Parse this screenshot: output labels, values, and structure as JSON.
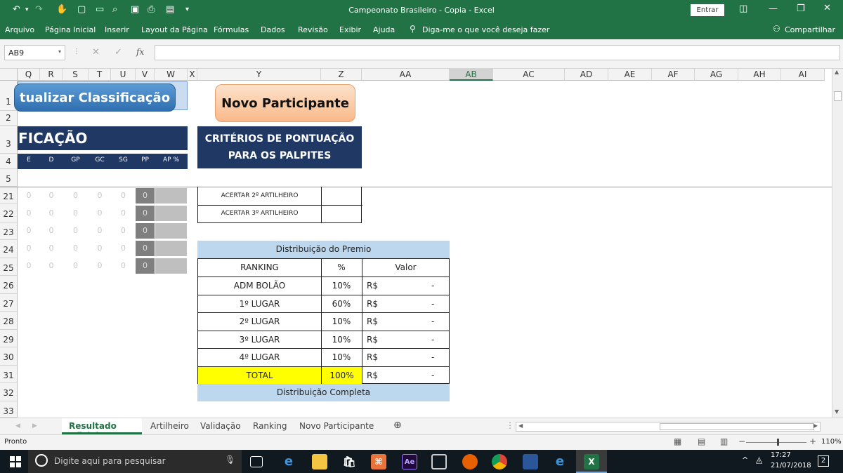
{
  "window": {
    "title": "Campeonato Brasileiro - Copia  -  Excel",
    "signin_label": "Entrar"
  },
  "ribbon": {
    "tabs": [
      "Arquivo",
      "Página Inicial",
      "Inserir",
      "Layout da Página",
      "Fórmulas",
      "Dados",
      "Revisão",
      "Exibir",
      "Ajuda"
    ],
    "tell_me": "Diga-me o que você deseja fazer",
    "share": "Compartilhar"
  },
  "formula_bar": {
    "name_box": "AB9",
    "fx": "fx",
    "formula": ""
  },
  "columns": [
    "Q",
    "R",
    "S",
    "T",
    "U",
    "V",
    "W",
    "X",
    "Y",
    "Z",
    "AA",
    "AB",
    "AC",
    "AD",
    "AE",
    "AF",
    "AG",
    "AH",
    "AI"
  ],
  "rows": [
    "1",
    "2",
    "3",
    "4",
    "5",
    "21",
    "22",
    "23",
    "24",
    "25",
    "26",
    "27",
    "28",
    "29",
    "30",
    "31",
    "32",
    "33"
  ],
  "buttons": {
    "atualizar": "tualizar Classificação",
    "novo": "Novo Participante"
  },
  "classificacao": {
    "banner": "FICAÇÃO",
    "headers": [
      "E",
      "D",
      "GP",
      "GC",
      "SG",
      "PP",
      "AP %"
    ],
    "rows": [
      [
        "0",
        "0",
        "0",
        "0",
        "0",
        "0",
        ""
      ],
      [
        "0",
        "0",
        "0",
        "0",
        "0",
        "0",
        ""
      ],
      [
        "0",
        "0",
        "0",
        "0",
        "0",
        "0",
        ""
      ],
      [
        "0",
        "0",
        "0",
        "0",
        "0",
        "0",
        ""
      ],
      [
        "0",
        "0",
        "0",
        "0",
        "0",
        "0",
        ""
      ]
    ]
  },
  "criterios": {
    "title_line1": "CRITÉRIOS DE PONTUAÇÃO",
    "title_line2": "PARA OS PALPITES",
    "items": [
      "ACERTAR  2º ARTILHEIRO",
      "ACERTAR  3º ARTILHEIRO"
    ]
  },
  "premio": {
    "title": "Distribuição do Premio",
    "headers": [
      "RANKING",
      "%",
      "Valor"
    ],
    "rows": [
      {
        "ranking": "ADM BOLÃO",
        "pct": "10%",
        "currency": "R$",
        "value": "-"
      },
      {
        "ranking": "1º LUGAR",
        "pct": "60%",
        "currency": "R$",
        "value": "-"
      },
      {
        "ranking": "2º LUGAR",
        "pct": "10%",
        "currency": "R$",
        "value": "-"
      },
      {
        "ranking": "3º LUGAR",
        "pct": "10%",
        "currency": "R$",
        "value": "-"
      },
      {
        "ranking": "4º LUGAR",
        "pct": "10%",
        "currency": "R$",
        "value": "-"
      }
    ],
    "total": {
      "ranking": "TOTAL",
      "pct": "100%",
      "currency": "R$",
      "value": "-"
    },
    "footer": "Distribuição Completa"
  },
  "sheets": [
    "Resultado Oficial",
    "Artilheiro",
    "Validação",
    "Ranking",
    "Novo Participante"
  ],
  "status": {
    "ready": "Pronto",
    "zoom": "110%"
  },
  "taskbar": {
    "search": "Digite aqui para pesquisar",
    "time": "17:27",
    "date": "21/07/2018",
    "notif": "2"
  }
}
